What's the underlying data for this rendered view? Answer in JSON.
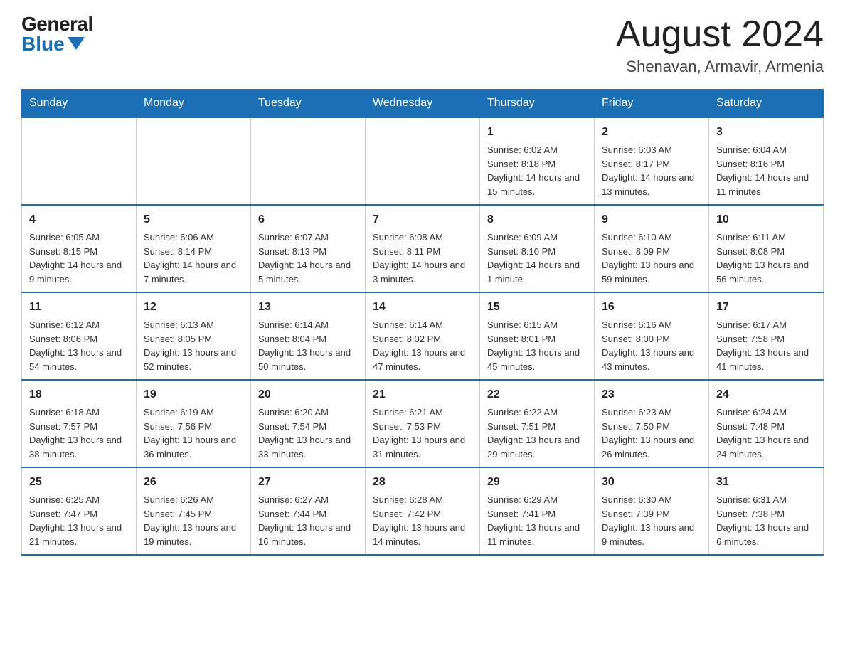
{
  "header": {
    "logo_general": "General",
    "logo_blue": "Blue",
    "month_year": "August 2024",
    "location": "Shenavan, Armavir, Armenia"
  },
  "days_of_week": [
    "Sunday",
    "Monday",
    "Tuesday",
    "Wednesday",
    "Thursday",
    "Friday",
    "Saturday"
  ],
  "weeks": [
    [
      {
        "day": "",
        "info": ""
      },
      {
        "day": "",
        "info": ""
      },
      {
        "day": "",
        "info": ""
      },
      {
        "day": "",
        "info": ""
      },
      {
        "day": "1",
        "info": "Sunrise: 6:02 AM\nSunset: 8:18 PM\nDaylight: 14 hours and 15 minutes."
      },
      {
        "day": "2",
        "info": "Sunrise: 6:03 AM\nSunset: 8:17 PM\nDaylight: 14 hours and 13 minutes."
      },
      {
        "day": "3",
        "info": "Sunrise: 6:04 AM\nSunset: 8:16 PM\nDaylight: 14 hours and 11 minutes."
      }
    ],
    [
      {
        "day": "4",
        "info": "Sunrise: 6:05 AM\nSunset: 8:15 PM\nDaylight: 14 hours and 9 minutes."
      },
      {
        "day": "5",
        "info": "Sunrise: 6:06 AM\nSunset: 8:14 PM\nDaylight: 14 hours and 7 minutes."
      },
      {
        "day": "6",
        "info": "Sunrise: 6:07 AM\nSunset: 8:13 PM\nDaylight: 14 hours and 5 minutes."
      },
      {
        "day": "7",
        "info": "Sunrise: 6:08 AM\nSunset: 8:11 PM\nDaylight: 14 hours and 3 minutes."
      },
      {
        "day": "8",
        "info": "Sunrise: 6:09 AM\nSunset: 8:10 PM\nDaylight: 14 hours and 1 minute."
      },
      {
        "day": "9",
        "info": "Sunrise: 6:10 AM\nSunset: 8:09 PM\nDaylight: 13 hours and 59 minutes."
      },
      {
        "day": "10",
        "info": "Sunrise: 6:11 AM\nSunset: 8:08 PM\nDaylight: 13 hours and 56 minutes."
      }
    ],
    [
      {
        "day": "11",
        "info": "Sunrise: 6:12 AM\nSunset: 8:06 PM\nDaylight: 13 hours and 54 minutes."
      },
      {
        "day": "12",
        "info": "Sunrise: 6:13 AM\nSunset: 8:05 PM\nDaylight: 13 hours and 52 minutes."
      },
      {
        "day": "13",
        "info": "Sunrise: 6:14 AM\nSunset: 8:04 PM\nDaylight: 13 hours and 50 minutes."
      },
      {
        "day": "14",
        "info": "Sunrise: 6:14 AM\nSunset: 8:02 PM\nDaylight: 13 hours and 47 minutes."
      },
      {
        "day": "15",
        "info": "Sunrise: 6:15 AM\nSunset: 8:01 PM\nDaylight: 13 hours and 45 minutes."
      },
      {
        "day": "16",
        "info": "Sunrise: 6:16 AM\nSunset: 8:00 PM\nDaylight: 13 hours and 43 minutes."
      },
      {
        "day": "17",
        "info": "Sunrise: 6:17 AM\nSunset: 7:58 PM\nDaylight: 13 hours and 41 minutes."
      }
    ],
    [
      {
        "day": "18",
        "info": "Sunrise: 6:18 AM\nSunset: 7:57 PM\nDaylight: 13 hours and 38 minutes."
      },
      {
        "day": "19",
        "info": "Sunrise: 6:19 AM\nSunset: 7:56 PM\nDaylight: 13 hours and 36 minutes."
      },
      {
        "day": "20",
        "info": "Sunrise: 6:20 AM\nSunset: 7:54 PM\nDaylight: 13 hours and 33 minutes."
      },
      {
        "day": "21",
        "info": "Sunrise: 6:21 AM\nSunset: 7:53 PM\nDaylight: 13 hours and 31 minutes."
      },
      {
        "day": "22",
        "info": "Sunrise: 6:22 AM\nSunset: 7:51 PM\nDaylight: 13 hours and 29 minutes."
      },
      {
        "day": "23",
        "info": "Sunrise: 6:23 AM\nSunset: 7:50 PM\nDaylight: 13 hours and 26 minutes."
      },
      {
        "day": "24",
        "info": "Sunrise: 6:24 AM\nSunset: 7:48 PM\nDaylight: 13 hours and 24 minutes."
      }
    ],
    [
      {
        "day": "25",
        "info": "Sunrise: 6:25 AM\nSunset: 7:47 PM\nDaylight: 13 hours and 21 minutes."
      },
      {
        "day": "26",
        "info": "Sunrise: 6:26 AM\nSunset: 7:45 PM\nDaylight: 13 hours and 19 minutes."
      },
      {
        "day": "27",
        "info": "Sunrise: 6:27 AM\nSunset: 7:44 PM\nDaylight: 13 hours and 16 minutes."
      },
      {
        "day": "28",
        "info": "Sunrise: 6:28 AM\nSunset: 7:42 PM\nDaylight: 13 hours and 14 minutes."
      },
      {
        "day": "29",
        "info": "Sunrise: 6:29 AM\nSunset: 7:41 PM\nDaylight: 13 hours and 11 minutes."
      },
      {
        "day": "30",
        "info": "Sunrise: 6:30 AM\nSunset: 7:39 PM\nDaylight: 13 hours and 9 minutes."
      },
      {
        "day": "31",
        "info": "Sunrise: 6:31 AM\nSunset: 7:38 PM\nDaylight: 13 hours and 6 minutes."
      }
    ]
  ]
}
